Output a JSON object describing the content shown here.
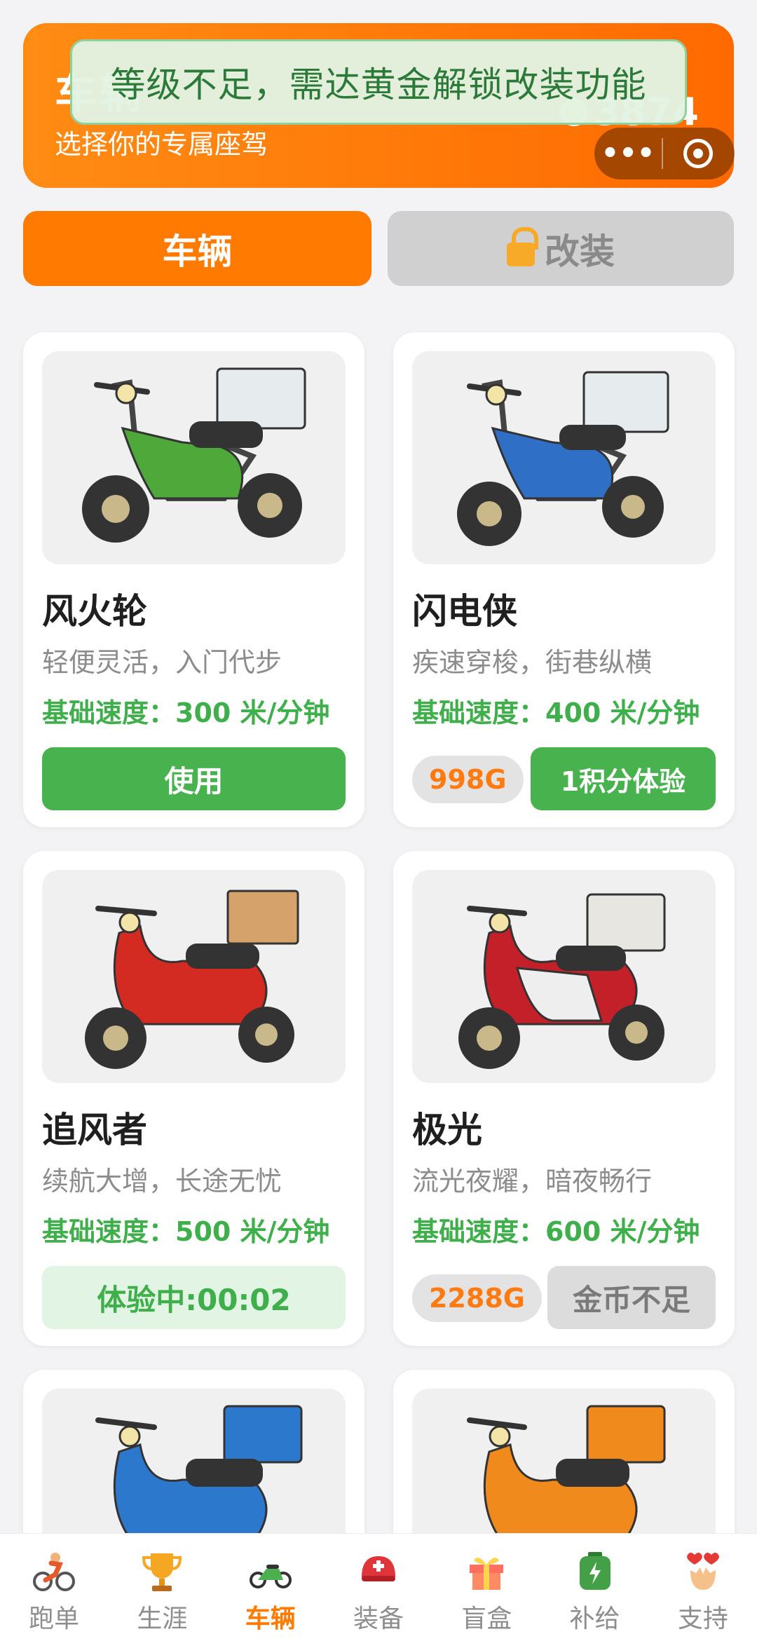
{
  "header": {
    "title": "车辆",
    "subtitle": "选择你的专属座驾",
    "coins": "3874"
  },
  "toast": "等级不足，需达黄金解锁改装功能",
  "tabs": {
    "vehicle": "车辆",
    "mod": "改装"
  },
  "vehicles": [
    {
      "name": "风火轮",
      "desc": "轻便灵活，入门代步",
      "speed": "基础速度：300 米/分钟",
      "action": "使用",
      "body_color": "#4fa83a"
    },
    {
      "name": "闪电侠",
      "desc": "疾速穿梭，街巷纵横",
      "speed": "基础速度：400 米/分钟",
      "price": "998G",
      "action": "1积分体验",
      "body_color": "#2f6fc6"
    },
    {
      "name": "追风者",
      "desc": "续航大增，长途无忧",
      "speed": "基础速度：500 米/分钟",
      "action": "体验中:00:02",
      "body_color": "#d32a22"
    },
    {
      "name": "极光",
      "desc": "流光夜耀，暗夜畅行",
      "speed": "基础速度：600 米/分钟",
      "price": "2288G",
      "action": "金币不足",
      "body_color": "#c4202a"
    },
    {
      "name": "",
      "desc": "",
      "speed": "",
      "action": "",
      "body_color": "#2c78cc"
    },
    {
      "name": "",
      "desc": "",
      "speed": "",
      "action": "",
      "body_color": "#f08a1c"
    }
  ],
  "nav": [
    {
      "label": "跑单",
      "icon": "rider-icon"
    },
    {
      "label": "生涯",
      "icon": "trophy-icon"
    },
    {
      "label": "车辆",
      "icon": "motorbike-icon"
    },
    {
      "label": "装备",
      "icon": "helmet-icon"
    },
    {
      "label": "盲盒",
      "icon": "gift-icon"
    },
    {
      "label": "补给",
      "icon": "battery-pack-icon"
    },
    {
      "label": "支持",
      "icon": "hands-icon"
    }
  ],
  "colors": {
    "accent": "#ff7a00",
    "green": "#48b24f"
  }
}
